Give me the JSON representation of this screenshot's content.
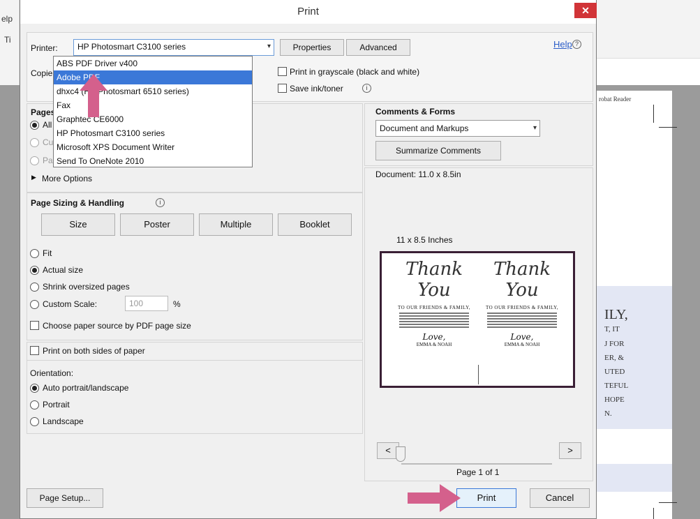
{
  "background": {
    "left_tab_1": "elp",
    "left_tab_2": "Ti",
    "right_header": "robat Reader",
    "doc_lines": [
      "ILY,",
      "T, IT",
      "J FOR",
      "ER, &",
      "UTED",
      "TEFUL",
      "HOPE",
      "N."
    ]
  },
  "dialog": {
    "title": "Print",
    "close_label": "✕",
    "printer": {
      "label": "Printer:",
      "selected": "HP Photosmart C3100 series",
      "options": [
        "ABS PDF Driver v400",
        "Adobe PDF",
        "dhxc4 (HP Photosmart 6510 series)",
        "Fax",
        "Graphtec CE6000",
        "HP Photosmart C3100 series",
        "Microsoft XPS Document Writer",
        "Send To OneNote 2010"
      ],
      "highlighted_index": 1
    },
    "properties_label": "Properties",
    "advanced_label": "Advanced",
    "help_label": "Help",
    "copies_label": "Copies:",
    "grayscale_label": "Print in grayscale (black and white)",
    "save_ink_label": "Save ink/toner",
    "pages": {
      "heading": "Pages to",
      "all": "All",
      "current": "Curre",
      "pages": "Pages",
      "more_options": "More Options"
    },
    "sizing": {
      "heading": "Page Sizing & Handling",
      "size_btn": "Size",
      "poster_btn": "Poster",
      "multiple_btn": "Multiple",
      "booklet_btn": "Booklet",
      "fit": "Fit",
      "actual": "Actual size",
      "shrink": "Shrink oversized pages",
      "custom": "Custom Scale:",
      "custom_value": "100",
      "percent": "%",
      "paper_source": "Choose paper source by PDF page size"
    },
    "both_sides_label": "Print on both sides of paper",
    "orientation": {
      "heading": "Orientation:",
      "auto": "Auto portrait/landscape",
      "portrait": "Portrait",
      "landscape": "Landscape"
    },
    "comments": {
      "heading": "Comments & Forms",
      "selected": "Document and Markups",
      "summarize_btn": "Summarize Comments"
    },
    "preview": {
      "document_size": "Document: 11.0 x 8.5in",
      "paper_size": "11 x 8.5 Inches",
      "card_script_1": "Thank",
      "card_script_2": "You",
      "card_caps": "TO OUR FRIENDS & FAMILY,",
      "card_love": "Love,",
      "card_names": "EMMA & NOAH",
      "prev_btn": "<",
      "next_btn": ">",
      "page_indicator": "Page 1 of 1"
    },
    "page_setup_btn": "Page Setup...",
    "print_btn": "Print",
    "cancel_btn": "Cancel"
  },
  "colors": {
    "selection": "#3b78d8",
    "close_red": "#d13438",
    "annotation_arrow": "#d4608c"
  }
}
